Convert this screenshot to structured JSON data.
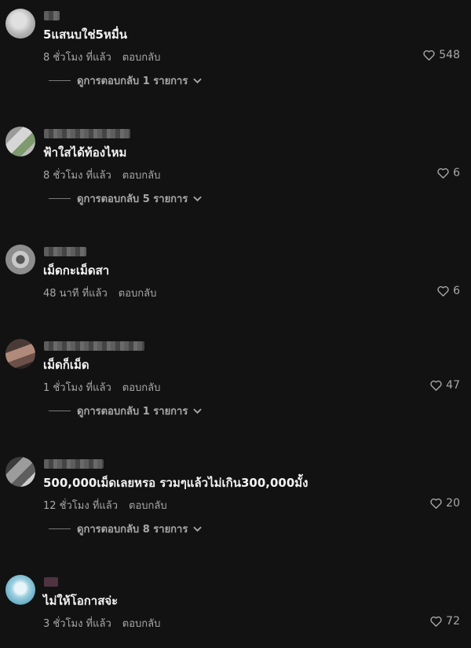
{
  "colors": {
    "background": "#121212",
    "text": "#f2f2f2",
    "meta": "#a8a8a8"
  },
  "comments": [
    {
      "text": "5แสนบใช่5หมื่น",
      "time": "8 ชั่วโมง ที่แล้ว",
      "reply_label": "ตอบกลับ",
      "likes": "548",
      "view_replies": "ดูการตอบกลับ 1 รายการ"
    },
    {
      "text": "ฟ้าใสได้ท้องไหม",
      "time": "8 ชั่วโมง ที่แล้ว",
      "reply_label": "ตอบกลับ",
      "likes": "6",
      "view_replies": "ดูการตอบกลับ 5 รายการ"
    },
    {
      "text": "เม็ดกะเม็ดสา",
      "time": "48 นาที ที่แล้ว",
      "reply_label": "ตอบกลับ",
      "likes": "6"
    },
    {
      "text": "เม็ดก็เม็ด",
      "time": "1 ชั่วโมง ที่แล้ว",
      "reply_label": "ตอบกลับ",
      "likes": "47",
      "view_replies": "ดูการตอบกลับ 1 รายการ"
    },
    {
      "text": "500,000เม็ดเลยหรอ รวมๆแล้วไม่เกิน300,000มั้ง",
      "time": "12 ชั่วโมง ที่แล้ว",
      "reply_label": "ตอบกลับ",
      "likes": "20",
      "view_replies": "ดูการตอบกลับ 8 รายการ"
    },
    {
      "text": "ไม่ให้โอกาสจ่ะ",
      "time": "3 ชั่วโมง ที่แล้ว",
      "reply_label": "ตอบกลับ",
      "likes": "72"
    }
  ]
}
